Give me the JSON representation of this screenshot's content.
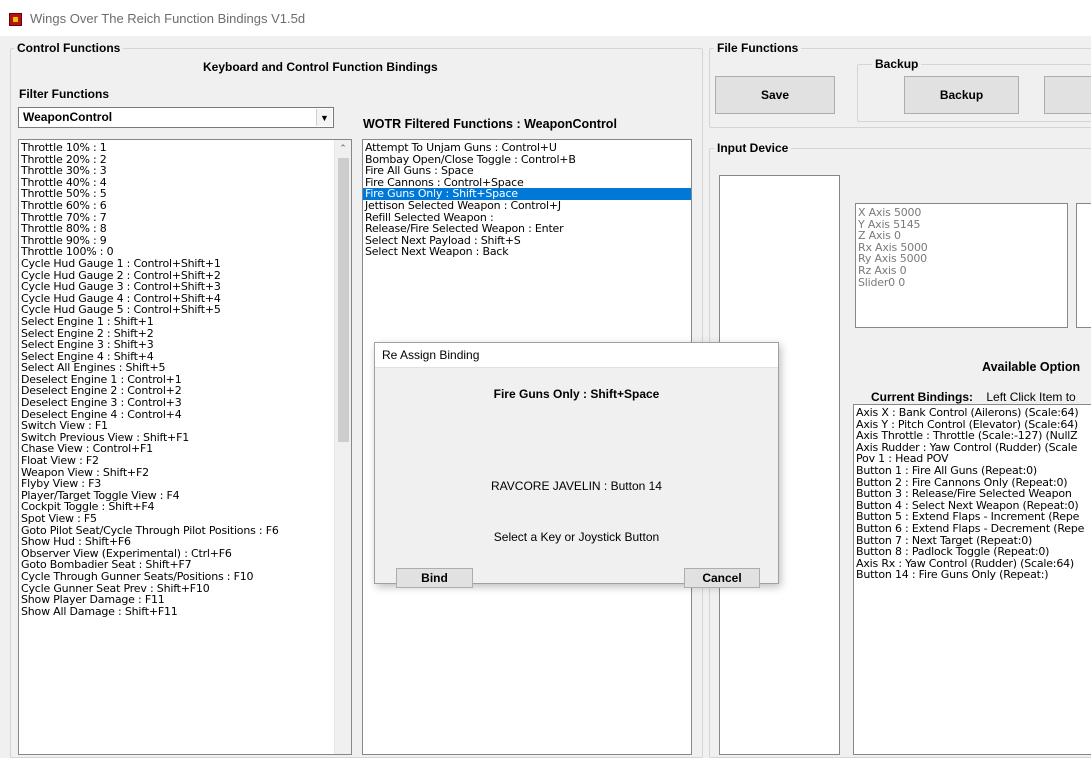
{
  "window": {
    "title": "Wings Over The Reich Function Bindings V1.5d"
  },
  "control_functions": {
    "group_title": "Control Functions",
    "heading": "Keyboard and Control Function Bindings",
    "filter_label": "Filter Functions",
    "filter_value": "WeaponControl",
    "filtered_heading": "WOTR Filtered Functions : WeaponControl",
    "all_functions": [
      "Throttle 10% : 1",
      "Throttle 20% : 2",
      "Throttle 30% : 3",
      "Throttle 40% : 4",
      "Throttle 50% : 5",
      "Throttle 60% : 6",
      "Throttle 70% : 7",
      "Throttle 80% : 8",
      "Throttle 90% : 9",
      "Throttle 100% : 0",
      "Cycle Hud Gauge 1 : Control+Shift+1",
      "Cycle Hud Gauge 2 : Control+Shift+2",
      "Cycle Hud Gauge 3 : Control+Shift+3",
      "Cycle Hud Gauge 4 : Control+Shift+4",
      "Cycle Hud Gauge 5 : Control+Shift+5",
      "Select Engine 1 : Shift+1",
      "Select Engine 2 : Shift+2",
      "Select Engine 3 : Shift+3",
      "Select Engine 4 : Shift+4",
      "Select All Engines : Shift+5",
      "Deselect Engine 1 : Control+1",
      "Deselect Engine 2 : Control+2",
      "Deselect Engine 3 : Control+3",
      "Deselect Engine 4 : Control+4",
      "Switch View : F1",
      "Switch Previous View : Shift+F1",
      "Chase View : Control+F1",
      "Float View : F2",
      "Weapon View : Shift+F2",
      "Flyby View : F3",
      "Player/Target Toggle View : F4",
      "Cockpit Toggle : Shift+F4",
      "Spot View : F5",
      "Goto Pilot Seat/Cycle Through Pilot Positions : F6",
      "Show Hud : Shift+F6",
      "Observer View (Experimental) : Ctrl+F6",
      "Goto Bombadier Seat : Shift+F7",
      "Cycle Through Gunner Seats/Positions : F10",
      "Cycle Gunner Seat Prev : Shift+F10",
      "Show Player Damage : F11",
      "Show All Damage : Shift+F11"
    ],
    "filtered_functions": [
      "Attempt To Unjam Guns : Control+U",
      "Bombay Open/Close Toggle : Control+B",
      "Fire All Guns : Space",
      "Fire Cannons : Control+Space",
      "Fire Guns Only : Shift+Space",
      "Jettison Selected Weapon : Control+J",
      "Refill Selected Weapon :",
      "Release/Fire Selected Weapon : Enter",
      "Select Next Payload : Shift+S",
      "Select Next Weapon : Back"
    ],
    "selected_filtered_index": 4
  },
  "file_functions": {
    "group_title": "File Functions",
    "save_label": "Save",
    "backup_group_title": "Backup",
    "backup_label": "Backup"
  },
  "input_device": {
    "group_title": "Input Device",
    "axes": [
      "X Axis 5000",
      "Y Axis 5145",
      "Z Axis 0",
      "Rx Axis 5000",
      "Ry Axis 5000",
      "Rz Axis 0",
      "Slider0 0"
    ],
    "available_options_label": "Available Option",
    "current_bindings_label": "Current Bindings:",
    "current_bindings_hint": "Left Click Item to",
    "current_bindings": [
      "Axis X : Bank Control (Ailerons)  (Scale:64)",
      "Axis Y : Pitch Control (Elevator)  (Scale:64)",
      "Axis Throttle : Throttle  (Scale:-127)  (NullZ",
      "Axis Rudder : Yaw Control (Rudder)  (Scale",
      "Pov 1 : Head POV",
      "Button 1 : Fire All Guns  (Repeat:0)",
      "Button 2 : Fire Cannons Only  (Repeat:0)",
      "Button 3 : Release/Fire Selected Weapon",
      "Button 4 : Select Next Weapon  (Repeat:0)",
      "Button 5 : Extend Flaps - Increment  (Repe",
      "Button 6 : Extend Flaps - Decrement  (Repe",
      "Button 7 : Next Target  (Repeat:0)",
      "Button 8 : Padlock Toggle  (Repeat:0)",
      "Axis Rx : Yaw Control (Rudder)  (Scale:64)",
      "Button 14 : Fire Guns Only  (Repeat:)"
    ]
  },
  "dialog": {
    "title": "Re Assign Binding",
    "function_name": "Fire Guns Only : Shift+Space",
    "device_button": "RAVCORE JAVELIN  : Button 14",
    "instruction": "Select a Key or Joystick Button",
    "bind_label": "Bind",
    "cancel_label": "Cancel"
  },
  "colors": {
    "selection": "#0078d7",
    "window_bg": "#f0f0f0",
    "app_icon": "#b31313"
  }
}
